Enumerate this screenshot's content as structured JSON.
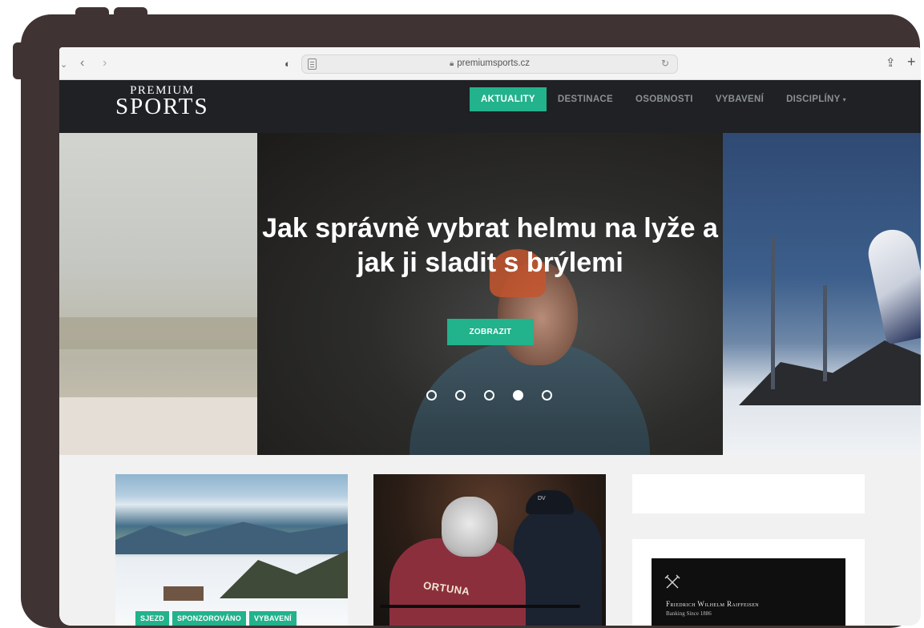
{
  "browser": {
    "url": "premiumsports.cz",
    "icons": [
      "chevron-down-icon",
      "back-icon",
      "forward-icon",
      "shield-icon",
      "reader-icon",
      "lock-icon",
      "reload-icon",
      "share-icon",
      "new-tab-icon"
    ]
  },
  "site": {
    "logo_top": "PREMIUM",
    "logo_main": "SPORTS",
    "nav": [
      {
        "label": "AKTUALITY",
        "active": true
      },
      {
        "label": "DESTINACE"
      },
      {
        "label": "OSOBNOSTI"
      },
      {
        "label": "VYBAVENÍ"
      },
      {
        "label": "DISCIPLÍNY"
      }
    ]
  },
  "hero": {
    "title": "Jak správně vybrat helmu na lyže a jak ji sladit s brýlemi",
    "button": "ZOBRAZIT",
    "slide_count": 5,
    "active_slide": 4
  },
  "cards": [
    {
      "tags": [
        "SJEZD",
        "SPONZOROVÁNO",
        "VYBAVENÍ"
      ]
    },
    {
      "image_text": "ORTUNA",
      "cap_text": "DV"
    }
  ],
  "ad": {
    "title": "Friedrich Wilhelm Raiffeisen",
    "subtitle": "Banking Since 1886"
  },
  "colors": {
    "accent": "#22b28c",
    "frame": "#3f3433",
    "nav_bg": "#1f2124"
  }
}
